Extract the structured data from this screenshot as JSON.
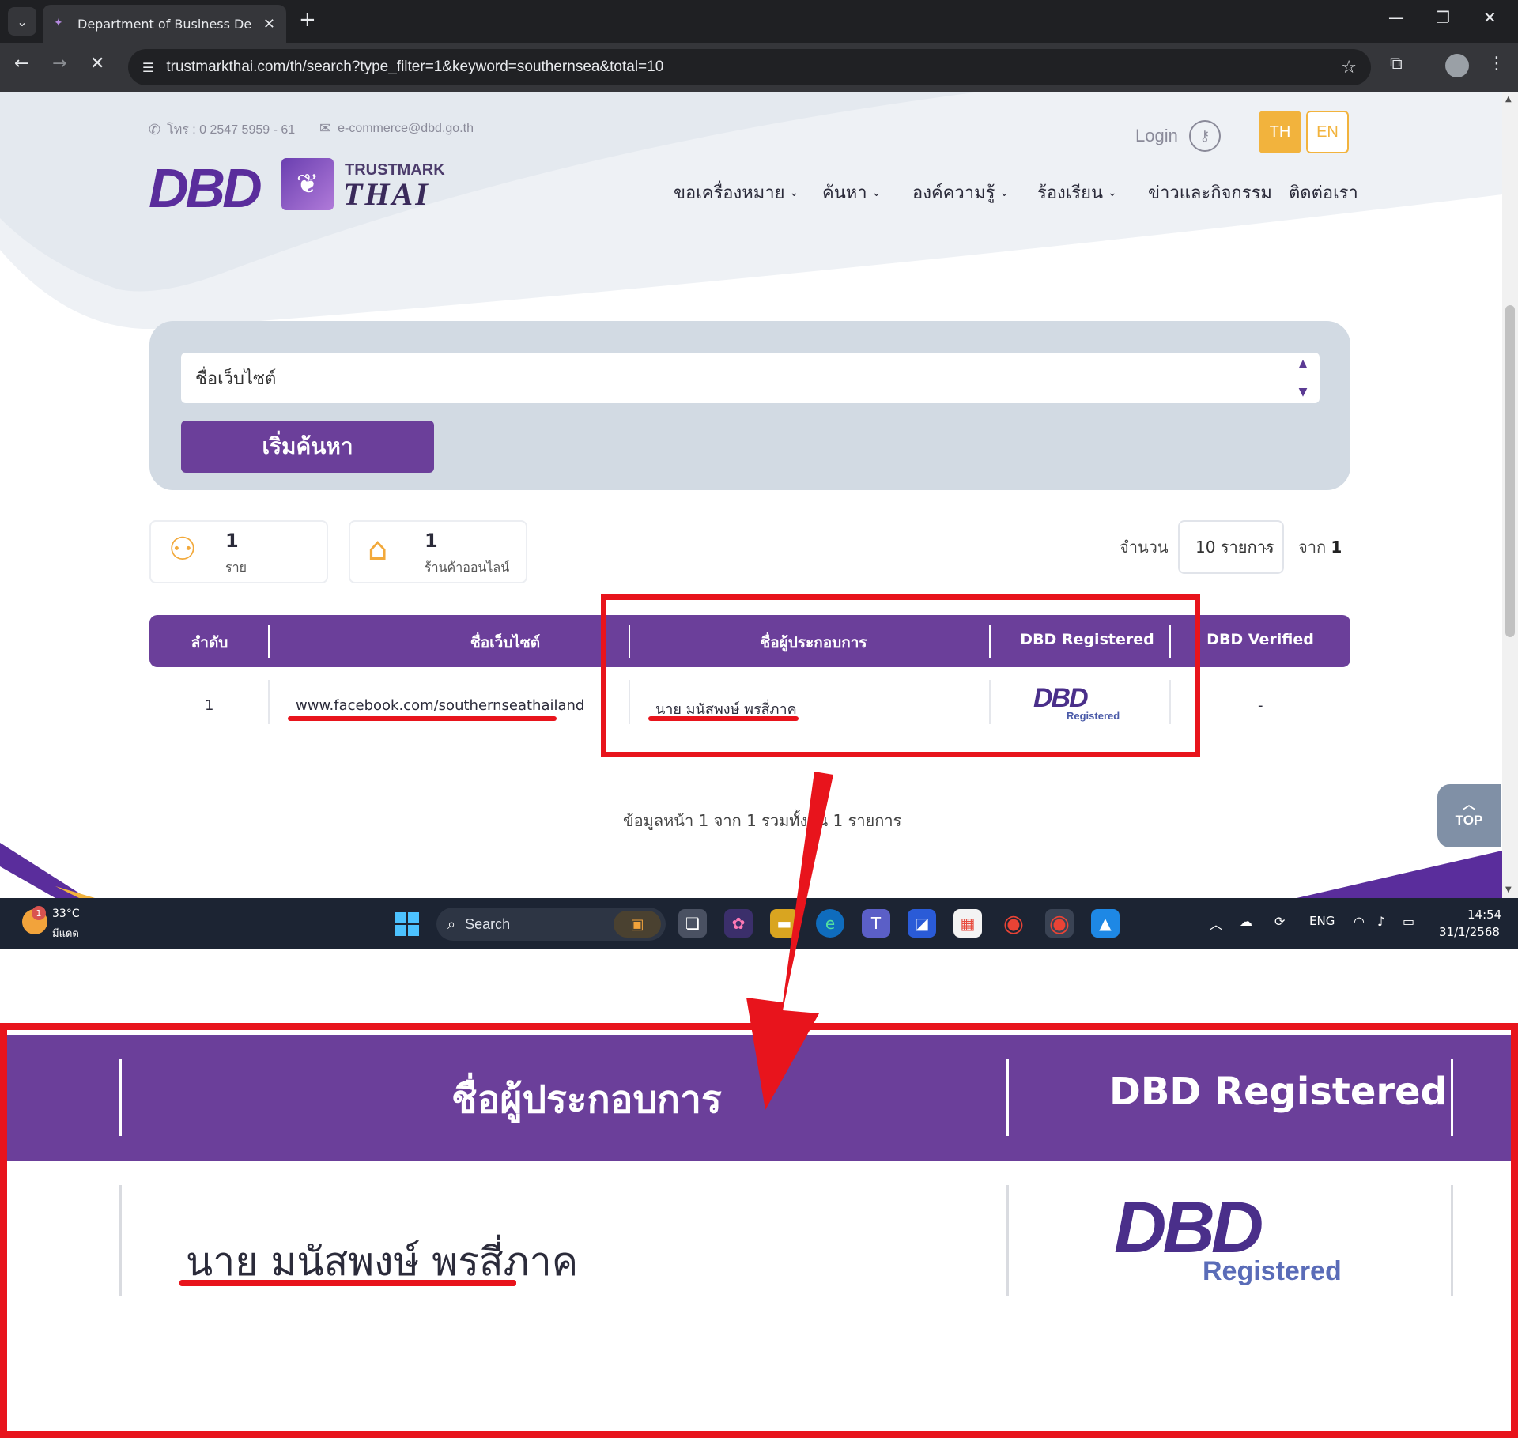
{
  "browser": {
    "tab_title": "Department of Business Develo",
    "url": "trustmarkthai.com/th/search?type_filter=1&keyword=southernsea&total=10"
  },
  "header": {
    "phone": "โทร : 0 2547 5959 - 61",
    "email": "e-commerce@dbd.go.th",
    "logo_dbd": "DBD",
    "logo_trustmark_top": "TRUSTMARK",
    "logo_trustmark_bottom": "THAI",
    "login_label": "Login",
    "lang_th": "TH",
    "lang_en": "EN",
    "nav": [
      {
        "label": "ขอเครื่องหมาย",
        "dropdown": true
      },
      {
        "label": "ค้นหา",
        "dropdown": true
      },
      {
        "label": "องค์ความรู้",
        "dropdown": true
      },
      {
        "label": "ร้องเรียน",
        "dropdown": true
      },
      {
        "label": "ข่าวและกิจกรรม",
        "dropdown": false
      },
      {
        "label": "ติดต่อเรา",
        "dropdown": false
      }
    ]
  },
  "search": {
    "field_value": "ชื่อเว็บไซต์",
    "button_label": "เริ่มค้นหา"
  },
  "stats": [
    {
      "icon": "person-icon",
      "count": "1",
      "label": "ราย"
    },
    {
      "icon": "store-icon",
      "count": "1",
      "label": "ร้านค้าออนไลน์"
    }
  ],
  "pagination": {
    "per_page_label": "จำนวน",
    "per_page_value": "10 รายการ",
    "of_label": "จาก",
    "of_value": "1",
    "summary_text": "ข้อมูลหน้า 1 จาก 1 รวมทั้งสิ้น 1 รายการ",
    "top_label": "TOP"
  },
  "table": {
    "headers": [
      "ลำดับ",
      "ชื่อเว็บไซต์",
      "ชื่อผู้ประกอบการ",
      "DBD Registered",
      "DBD Verified"
    ],
    "rows": [
      {
        "index": "1",
        "website": "www.facebook.com/southernseathailand",
        "operator": "นาย มนัสพงษ์ พรสี่ภาค",
        "registered_logo": "DBD",
        "registered_text": "Registered",
        "verified": "-"
      }
    ]
  },
  "taskbar": {
    "weather_temp": "33°C",
    "weather_cond": "มีแดด",
    "weather_badge": "1",
    "search_label": "Search",
    "lang": "ENG",
    "time": "14:54",
    "date": "31/1/2568"
  },
  "zoom": {
    "header_operator": "ชื่อผู้ประกอบการ",
    "header_registered": "DBD Registered",
    "operator_name": "นาย มนัสพงษ์ พรสี่ภาค",
    "registered_logo": "DBD",
    "registered_text": "Registered"
  },
  "colors": {
    "brand_purple": "#6b3f9a",
    "accent_orange": "#f2b33d",
    "annotation_red": "#e8141c"
  }
}
